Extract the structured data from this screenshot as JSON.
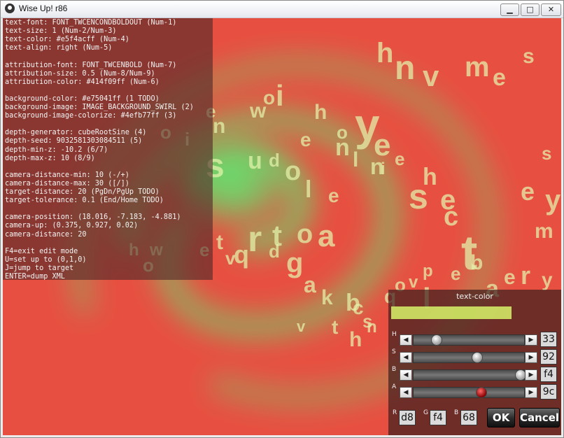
{
  "window": {
    "title": "Wise Up! r86",
    "btn_min": "▁",
    "btn_max": "□",
    "btn_close": "✕"
  },
  "colors": {
    "background": "#e75041",
    "swirl": "#4efb77",
    "text": "#e5f4ac",
    "swatch": "#d8f468"
  },
  "info": {
    "lines": [
      "text-font: FONT_TWCENCONDBOLDOUT (Num-1)",
      "text-size: 1 (Num-2/Num-3)",
      "text-color: #e5f4acff (Num-4)",
      "text-align: right (Num-5)",
      "",
      "attribution-font: FONT_TWCENBOLD (Num-7)",
      "attribution-size: 0.5 (Num-8/Num-9)",
      "attribution-color: #414f09ff (Num-6)",
      "",
      "background-color: #e75041ff (1 TODO)",
      "background-image: IMAGE_BACKGROUND_SWIRL (2)",
      "background-image-colorize: #4efb77ff (3)",
      "",
      "depth-generator: cubeRootSine (4)",
      "depth-seed: 9032581303084511 (5)",
      "depth-min-z: -10.2 (6/7)",
      "depth-max-z: 10 (8/9)",
      "",
      "camera-distance-min: 10 (-/+)",
      "camera-distance-max: 30 ([/])",
      "target-distance: 20 (PgDn/PgUp TODO)",
      "target-tolerance: 0.1 (End/Home TODO)",
      "",
      "camera-position: (18.016, -7.183, -4.881)",
      "camera-up: (0.375, 0.927, 0.02)",
      "camera-distance: 20",
      "",
      "F4=exit edit mode",
      "U=set up to (0,1,0)",
      "J=jump to target",
      "ENTER=dump XML"
    ]
  },
  "editor": {
    "title": "text-color",
    "sliders": [
      {
        "label": "H",
        "value": "33",
        "fraction": 0.2
      },
      {
        "label": "S",
        "value": "92",
        "fraction": 0.57
      },
      {
        "label": "B",
        "value": "f4",
        "fraction": 0.96
      },
      {
        "label": "A",
        "value": "9c",
        "fraction": 0.61
      }
    ],
    "rgb": {
      "r_label": "R",
      "r": "d8",
      "g_label": "G",
      "g": "f4",
      "b_label": "B",
      "b": "68"
    },
    "ok": "OK",
    "cancel": "Cancel",
    "arrow_left": "◀",
    "arrow_right": "▶"
  },
  "scene_letters": "hnvmesyeiowhoensudolelnieshectlrtoatvqdgakbcsqovpebaeryt"
}
